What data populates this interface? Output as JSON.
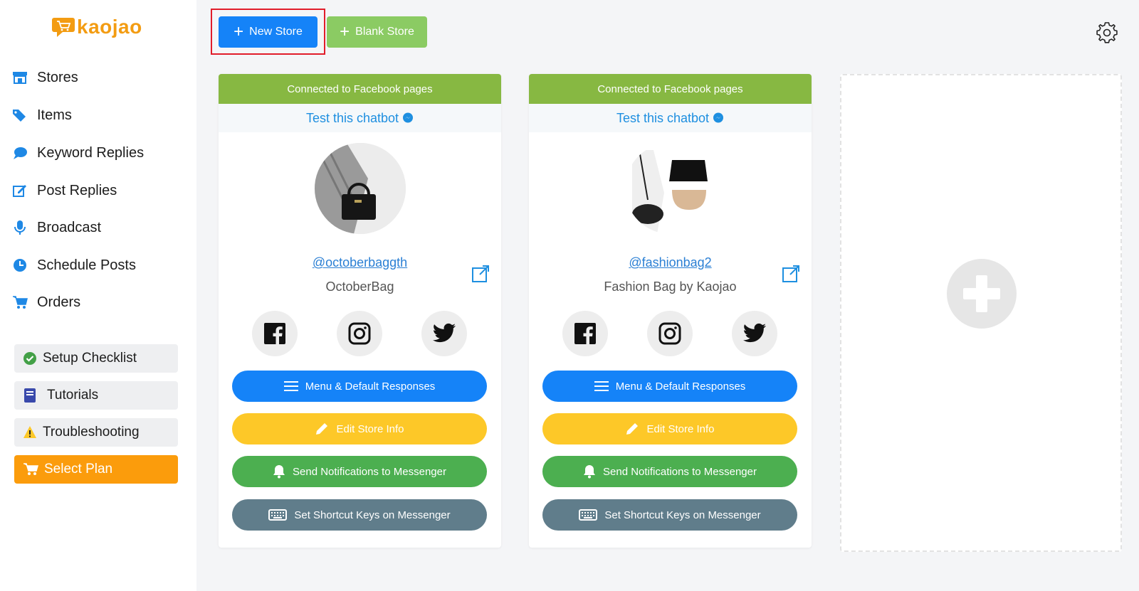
{
  "app": {
    "logo_text": "kaojao"
  },
  "sidebar": {
    "nav": [
      {
        "label": "Stores",
        "icon": "store-icon"
      },
      {
        "label": "Items",
        "icon": "tags-icon"
      },
      {
        "label": "Keyword Replies",
        "icon": "comment-icon"
      },
      {
        "label": "Post Replies",
        "icon": "edit-icon"
      },
      {
        "label": "Broadcast",
        "icon": "microphone-icon"
      },
      {
        "label": "Schedule Posts",
        "icon": "clock-icon"
      },
      {
        "label": "Orders",
        "icon": "cart-icon"
      }
    ],
    "setup_checklist": "Setup Checklist",
    "tutorials": "Tutorials",
    "troubleshooting": "Troubleshooting",
    "select_plan": "Select Plan"
  },
  "toolbar": {
    "new_store": "New Store",
    "blank_store": "Blank Store"
  },
  "stores": [
    {
      "status": "Connected to Facebook pages",
      "test_label": "Test this chatbot",
      "handle": "@octoberbaggth",
      "name": "OctoberBag",
      "buttons": {
        "menu": "Menu & Default Responses",
        "edit": "Edit Store Info",
        "notify": "Send Notifications to Messenger",
        "shortcut": "Set Shortcut Keys on Messenger"
      }
    },
    {
      "status": "Connected to Facebook pages",
      "test_label": "Test this chatbot",
      "handle": "@fashionbag2",
      "name": "Fashion Bag by Kaojao",
      "buttons": {
        "menu": "Menu & Default Responses",
        "edit": "Edit Store Info",
        "notify": "Send Notifications to Messenger",
        "shortcut": "Set Shortcut Keys on Messenger"
      }
    }
  ],
  "colors": {
    "primary": "#1583f8",
    "green_light": "#8bcb63",
    "header_green": "#87b842",
    "yellow": "#fdc828",
    "green": "#4caf50",
    "slate": "#607d8b",
    "orange": "#fb9c0c",
    "highlight": "#e11d2a"
  }
}
